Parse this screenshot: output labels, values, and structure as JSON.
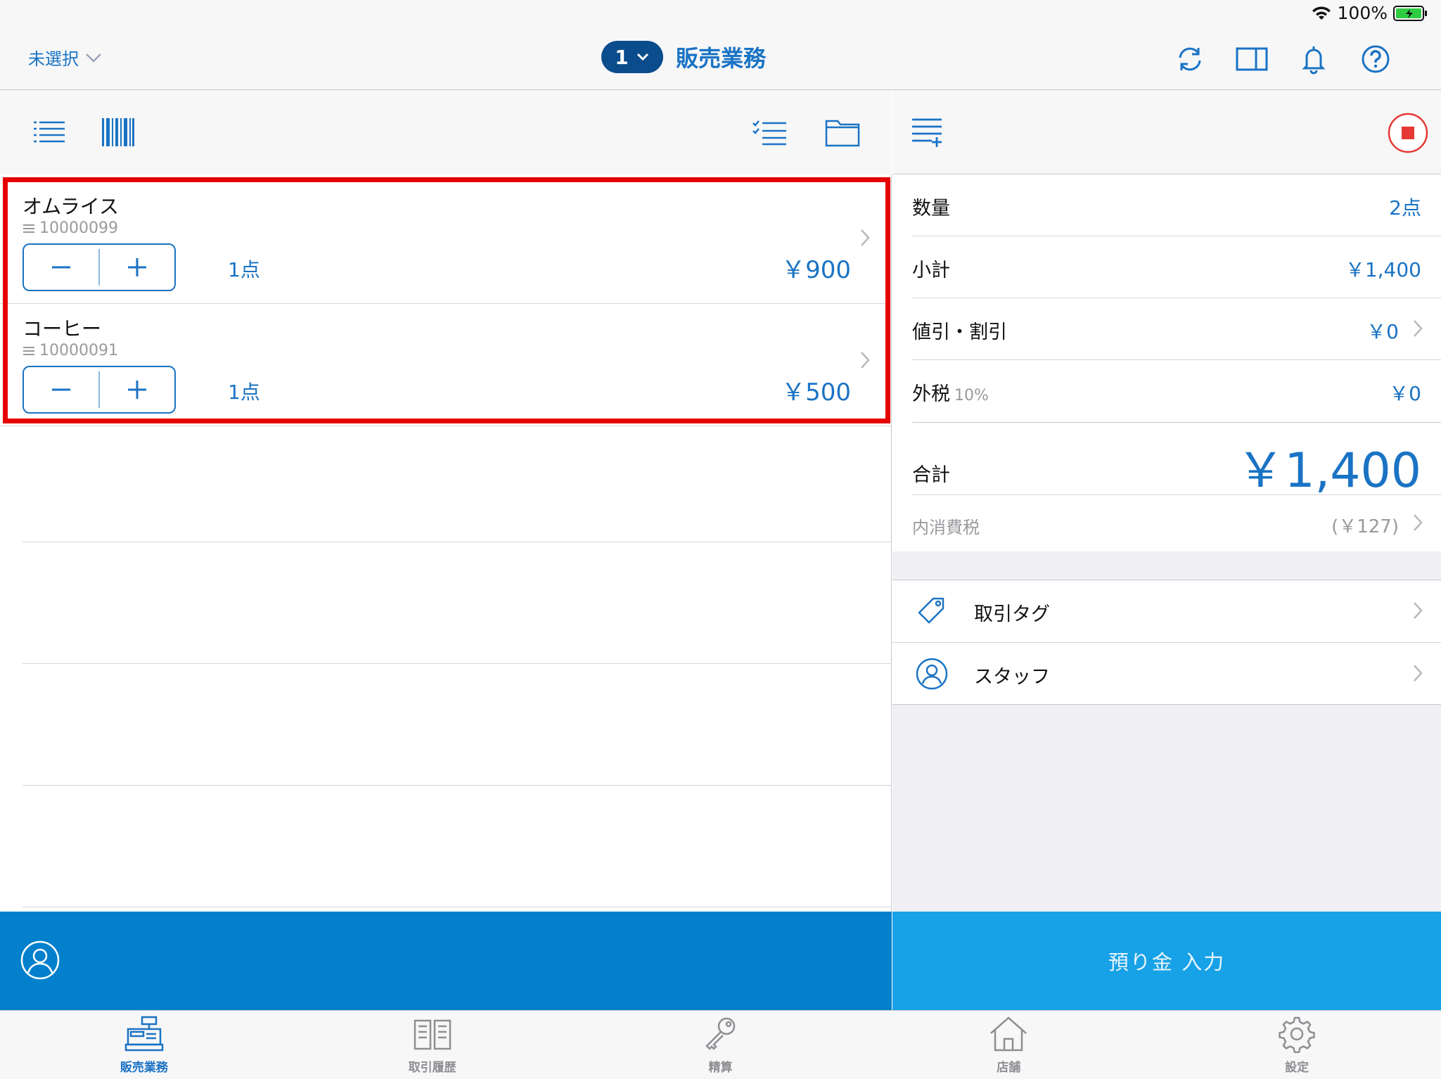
{
  "status_bar": {
    "battery": "100%"
  },
  "navbar": {
    "store_label": "未選択",
    "register_number": "1",
    "title": "販売業務"
  },
  "cart": {
    "items": [
      {
        "name": "オムライス",
        "code": "10000099",
        "qty": "1点",
        "price": "￥900"
      },
      {
        "name": "コーヒー",
        "code": "10000091",
        "qty": "1点",
        "price": "￥500"
      }
    ]
  },
  "summary": {
    "quantity_label": "数量",
    "quantity_value": "2点",
    "subtotal_label": "小計",
    "subtotal_value": "￥1,400",
    "discount_label": "値引・割引",
    "discount_value": "￥0",
    "tax_label": "外税",
    "tax_rate": "10%",
    "tax_value": "￥0",
    "total_label": "合計",
    "total_value": "￥1,400",
    "inclusive_tax_label": "内消費税",
    "inclusive_tax_value": "(￥127)"
  },
  "extras": {
    "tag_label": "取引タグ",
    "staff_label": "スタッフ"
  },
  "deposit_button": "預り金 入力",
  "tabs": [
    {
      "label": "販売業務"
    },
    {
      "label": "取引履歴"
    },
    {
      "label": "精算"
    },
    {
      "label": "店舗"
    },
    {
      "label": "設定"
    }
  ],
  "colors": {
    "accent": "#1a73c4",
    "customer_bar": "#0280cc",
    "deposit_button": "#17a1e6",
    "highlight": "#e60000",
    "stop_button": "#e53935"
  }
}
